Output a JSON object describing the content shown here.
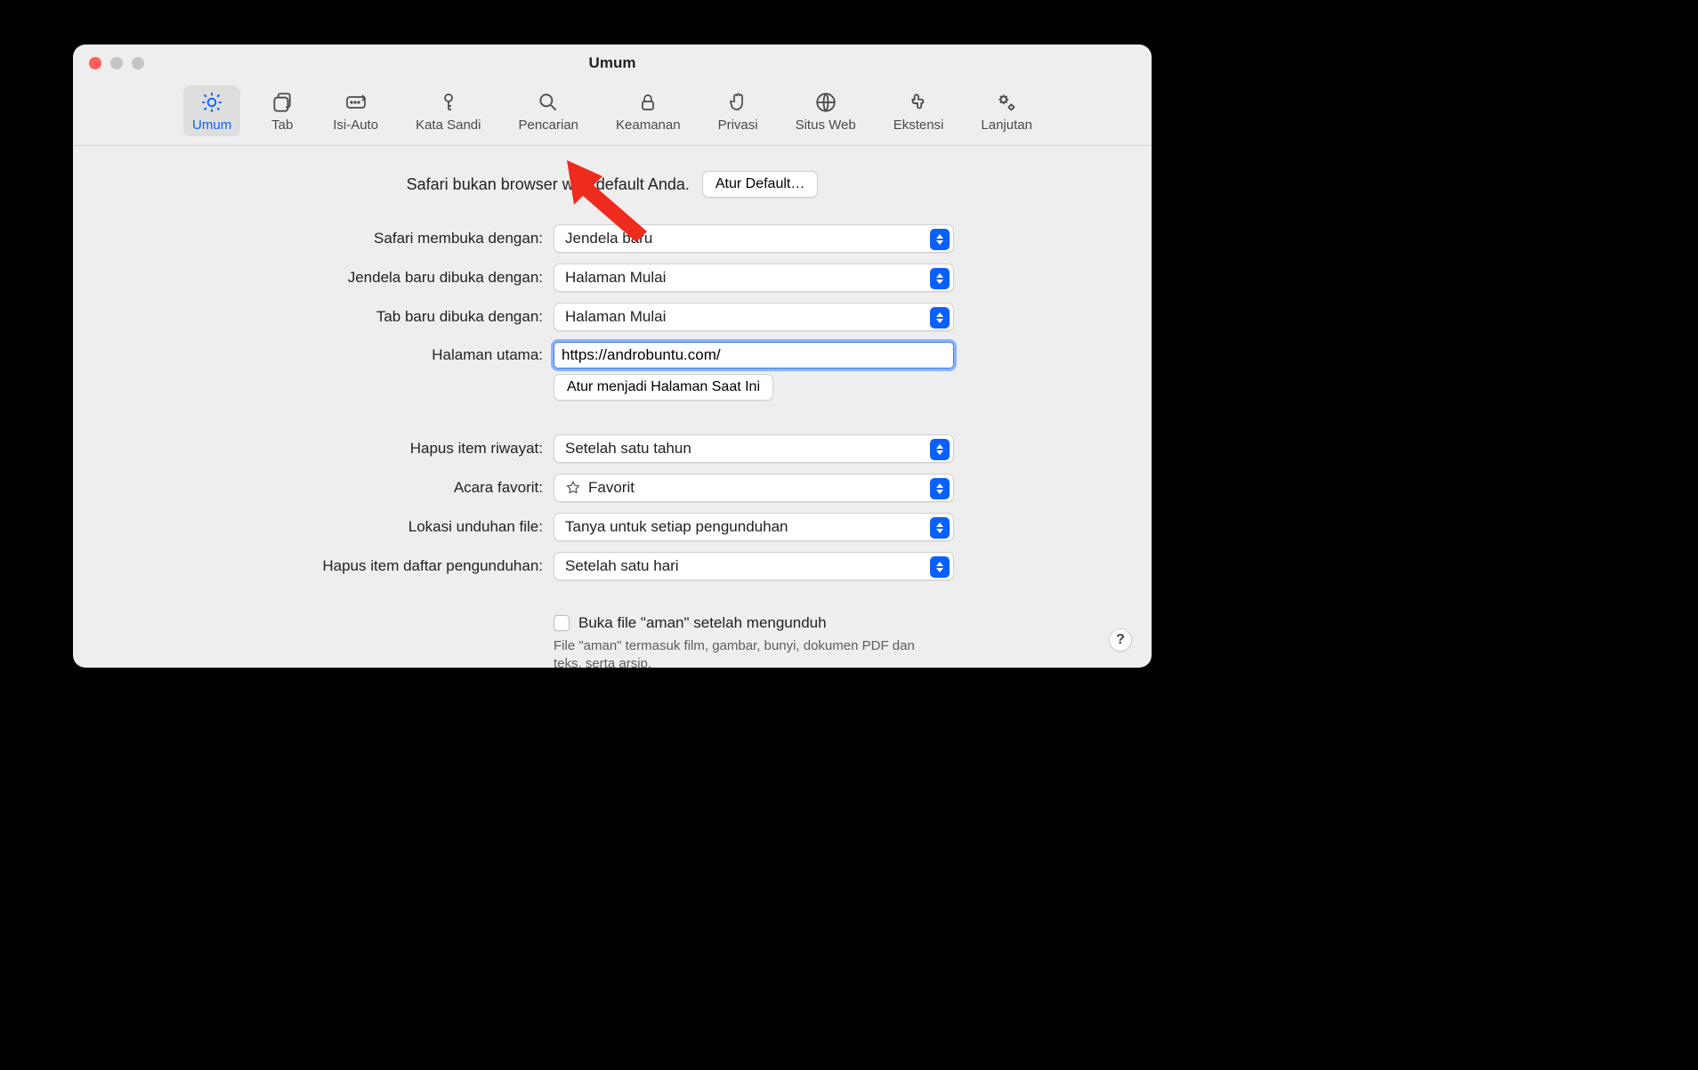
{
  "window": {
    "title": "Umum"
  },
  "toolbar": {
    "items": [
      {
        "label": "Umum"
      },
      {
        "label": "Tab"
      },
      {
        "label": "Isi-Auto"
      },
      {
        "label": "Kata Sandi"
      },
      {
        "label": "Pencarian"
      },
      {
        "label": "Keamanan"
      },
      {
        "label": "Privasi"
      },
      {
        "label": "Situs Web"
      },
      {
        "label": "Ekstensi"
      },
      {
        "label": "Lanjutan"
      }
    ]
  },
  "banner": {
    "text": "Safari bukan browser web default Anda.",
    "button": "Atur Default…"
  },
  "labels": {
    "opens_with": "Safari membuka dengan:",
    "new_window": "Jendela baru dibuka dengan:",
    "new_tab": "Tab baru dibuka dengan:",
    "homepage": "Halaman utama:",
    "set_current": "Atur menjadi Halaman Saat Ini",
    "history": "Hapus item riwayat:",
    "fav_event": "Acara favorit:",
    "download_loc": "Lokasi unduhan file:",
    "download_clear": "Hapus item daftar pengunduhan:",
    "open_safe": "Buka file \"aman\" setelah mengunduh",
    "open_safe_desc": "File \"aman\" termasuk film, gambar, bunyi, dokumen PDF dan teks, serta arsip."
  },
  "values": {
    "opens_with": "Jendela baru",
    "new_window": "Halaman Mulai",
    "new_tab": "Halaman Mulai",
    "homepage": "https://androbuntu.com/",
    "history": "Setelah satu tahun",
    "fav_event": "Favorit",
    "download_loc": "Tanya untuk setiap pengunduhan",
    "download_clear": "Setelah satu hari"
  },
  "help_glyph": "?"
}
